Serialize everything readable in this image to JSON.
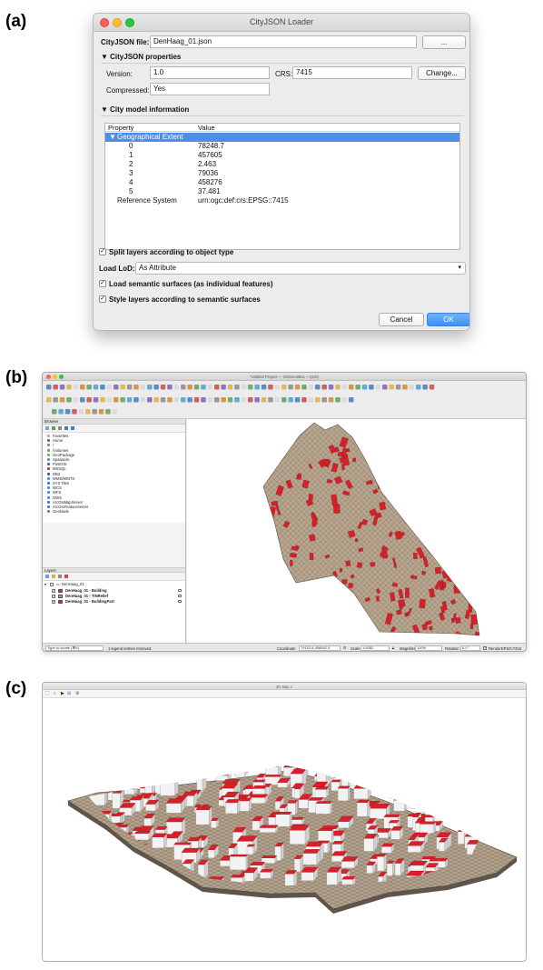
{
  "labels": {
    "a": "(a)",
    "b": "(b)",
    "c": "(c)"
  },
  "loader": {
    "window_title": "CityJSON Loader",
    "file_label": "CityJSON file:",
    "file_value": "DenHaag_01.json",
    "browse_label": "...",
    "properties_header": "CityJSON properties",
    "version_label": "Version:",
    "version_value": "1.0",
    "crs_label": "CRS:",
    "crs_value": "7415",
    "change_label": "Change...",
    "compressed_label": "Compressed:",
    "compressed_value": "Yes",
    "model_header": "City model information",
    "col_property": "Property",
    "col_value": "Value",
    "extent_label": "Geographical Extent",
    "extent_rows": [
      {
        "key": "0",
        "value": "78248.7"
      },
      {
        "key": "1",
        "value": "457605"
      },
      {
        "key": "2",
        "value": "2.463"
      },
      {
        "key": "3",
        "value": "79036"
      },
      {
        "key": "4",
        "value": "458276"
      },
      {
        "key": "5",
        "value": "37.481"
      }
    ],
    "refsys_label": "Reference System",
    "refsys_value": "urn:ogc:def:crs:EPSG::7415",
    "split_label": "Split layers according to object type",
    "lod_label": "Load LoD:",
    "lod_value": "As Attribute",
    "semantic_label": "Load semantic surfaces (as individual features)",
    "style_label": "Style layers according to semantic surfaces",
    "cancel_label": "Cancel",
    "ok_label": "OK"
  },
  "qgis": {
    "window_title": "*Untitled Project — OSGeo4Mac – QGIS",
    "browser_title": "Browser",
    "browser_items": [
      "Favorites",
      "Home",
      "/",
      "/Volumes",
      "GeoPackage",
      "SpatiaLite",
      "PostGIS",
      "MSSQL",
      "DB2",
      "WMS/WMTS",
      "XYZ Tiles",
      "WCS",
      "WFS",
      "OWS",
      "ArcGisMapServer",
      "ArcGisFeatureServer",
      "GeoNode"
    ],
    "layers_title": "Layers",
    "group_name": "DenHaag_01",
    "layers": [
      {
        "name": "DenHaag_01 - Building",
        "color": "#c8323a"
      },
      {
        "name": "DenHaag_01 - TINRelief",
        "color": "#a89986"
      },
      {
        "name": "DenHaag_01 - BuildingPart",
        "color": "#c8323a"
      }
    ],
    "locate_placeholder": "Type to locate (⌘K)",
    "status_message": "1 legend entries removed.",
    "coordinate_label": "Coordinate",
    "coordinate_value": "79162.8,458582.5",
    "scale_label": "Scale",
    "scale_value": "1:5382",
    "magnifier_label": "Magnifier",
    "magnifier_value": "100%",
    "rotation_label": "Rotation",
    "rotation_value": "0.0 °",
    "render_label": "Render",
    "crs_label": "EPSG:7415"
  },
  "map3d": {
    "window_title": "3D Map 1"
  },
  "colors": {
    "roof_red": "#d8202b",
    "terrain": "#b3a28d",
    "wall": "#f2f2f2",
    "selection_blue": "#4e8fe6"
  }
}
